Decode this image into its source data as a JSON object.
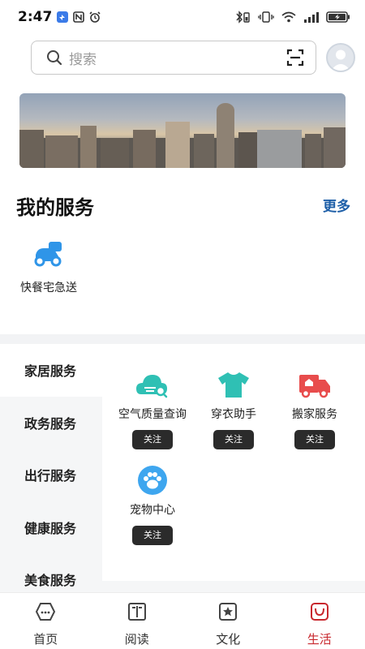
{
  "status_bar": {
    "time": "2:47"
  },
  "search": {
    "placeholder": "搜索"
  },
  "my_services": {
    "title": "我的服务",
    "more": "更多",
    "items": [
      {
        "label": "快餐宅急送",
        "icon": "scooter-icon",
        "color": "#2f95e8"
      }
    ]
  },
  "categories": {
    "items": [
      "家居服务",
      "政务服务",
      "出行服务",
      "健康服务",
      "美食服务"
    ],
    "active_index": 0
  },
  "services": {
    "follow_label": "关注",
    "tiles": [
      {
        "label": "空气质量查询",
        "icon": "cloud-search-icon",
        "color": "#2fc0b4"
      },
      {
        "label": "穿衣助手",
        "icon": "tshirt-icon",
        "color": "#2fc0b4"
      },
      {
        "label": "搬家服务",
        "icon": "moving-truck-icon",
        "color": "#e84c4c"
      },
      {
        "label": "宠物中心",
        "icon": "paw-icon",
        "color": "#3ea6ef"
      }
    ]
  },
  "bottom_nav": {
    "items": [
      {
        "label": "首页",
        "icon": "home-icon"
      },
      {
        "label": "阅读",
        "icon": "book-icon"
      },
      {
        "label": "文化",
        "icon": "culture-icon"
      },
      {
        "label": "生活",
        "icon": "life-bag-icon"
      }
    ],
    "active_index": 3,
    "active_color": "#c8282e"
  }
}
